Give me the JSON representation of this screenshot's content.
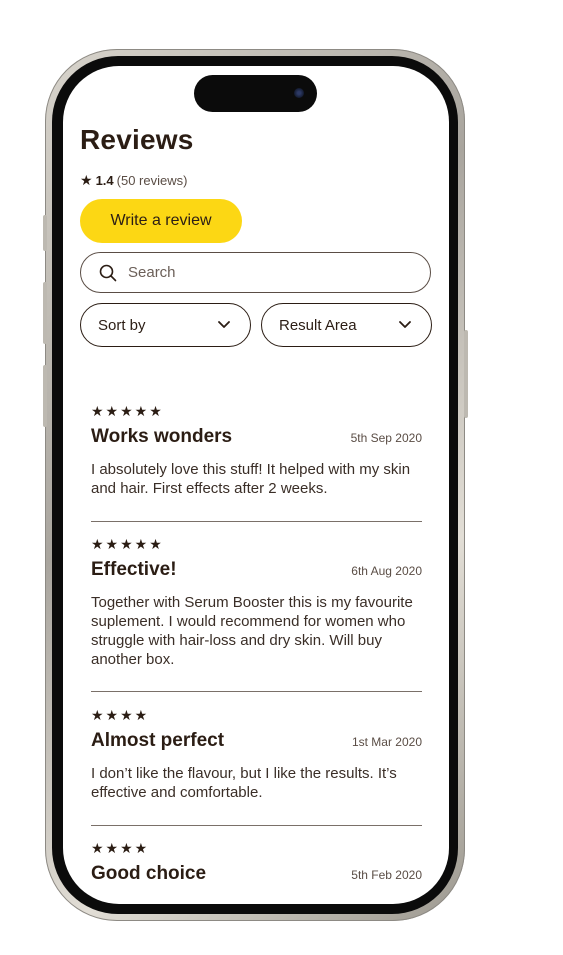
{
  "page": {
    "title": "Reviews",
    "rating": {
      "star_icon": "star-icon",
      "value": "1.4",
      "count_text": "(50 reviews)"
    },
    "write_review_label": "Write a review",
    "search": {
      "placeholder": "Search",
      "value": "",
      "icon": "search-icon"
    },
    "filters": [
      {
        "label": "Sort by",
        "icon": "chevron-down-icon"
      },
      {
        "label": "Result Area",
        "icon": "chevron-down-icon"
      }
    ]
  },
  "reviews": [
    {
      "stars": 5,
      "stars_text": "★★★★★",
      "title": "Works wonders",
      "date": "5th Sep 2020",
      "body": "I absolutely love this stuff! It helped with my skin and hair. First effects after 2 weeks."
    },
    {
      "stars": 5,
      "stars_text": "★★★★★",
      "title": "Effective!",
      "date": "6th Aug 2020",
      "body": "Together with Serum Booster this is my favourite suplement. I would recommend for women who struggle with hair-loss and dry skin. Will buy another box."
    },
    {
      "stars": 4,
      "stars_text": "★★★★",
      "title": "Almost perfect",
      "date": "1st Mar 2020",
      "body": "I don’t like the flavour, but I like the results. It’s effective and comfortable."
    },
    {
      "stars": 4,
      "stars_text": "★★★★",
      "title": "Good choice",
      "date": "5th Feb 2020",
      "body": ""
    }
  ],
  "colors": {
    "accent": "#fcd714",
    "text": "#2b1d14",
    "frame": "#0b0b0b"
  }
}
